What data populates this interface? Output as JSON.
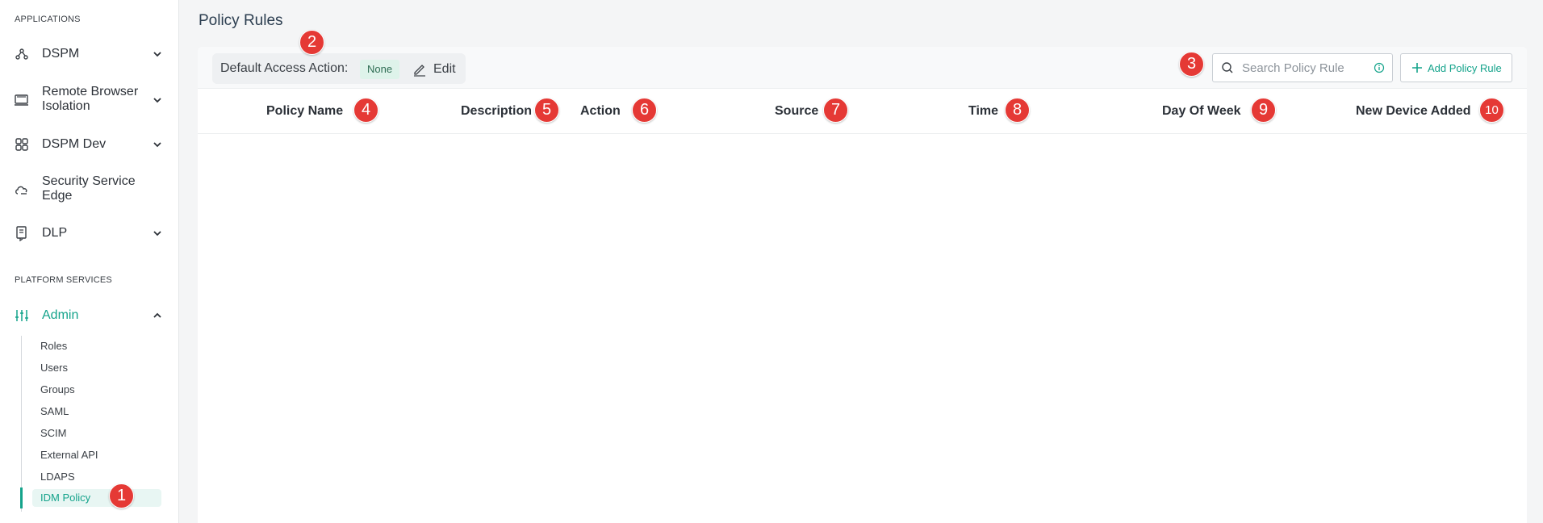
{
  "sidebar": {
    "applications_title": "APPLICATIONS",
    "applications": [
      {
        "label": "DSPM",
        "icon": "nodes-icon"
      },
      {
        "label": "Remote Browser Isolation",
        "icon": "browser-window-icon"
      },
      {
        "label": "DSPM Dev",
        "icon": "grid-icon"
      },
      {
        "label": "Security Service Edge",
        "icon": "cloud-icon"
      },
      {
        "label": "DLP",
        "icon": "document-icon"
      }
    ],
    "platform_title": "PLATFORM SERVICES",
    "admin": {
      "label": "Admin",
      "icon": "sliders-icon"
    },
    "admin_items": [
      "Roles",
      "Users",
      "Groups",
      "SAML",
      "SCIM",
      "External API",
      "LDAPS",
      "IDM Policy"
    ]
  },
  "main": {
    "page_title": "Policy Rules",
    "access": {
      "label": "Default Access Action:",
      "value": "None",
      "edit_label": "Edit"
    },
    "search": {
      "placeholder": "Search Policy Rule"
    },
    "add_button": "Add Policy Rule",
    "columns": [
      "Policy Name",
      "Description",
      "Action",
      "Source",
      "Time",
      "Day Of Week",
      "New Device Added"
    ],
    "rows": []
  },
  "markers": [
    "1",
    "2",
    "3",
    "4",
    "5",
    "6",
    "7",
    "8",
    "9",
    "10"
  ],
  "colors": {
    "accent": "#14a38b",
    "marker": "#e53935",
    "badge_bg": "#def3ea"
  }
}
